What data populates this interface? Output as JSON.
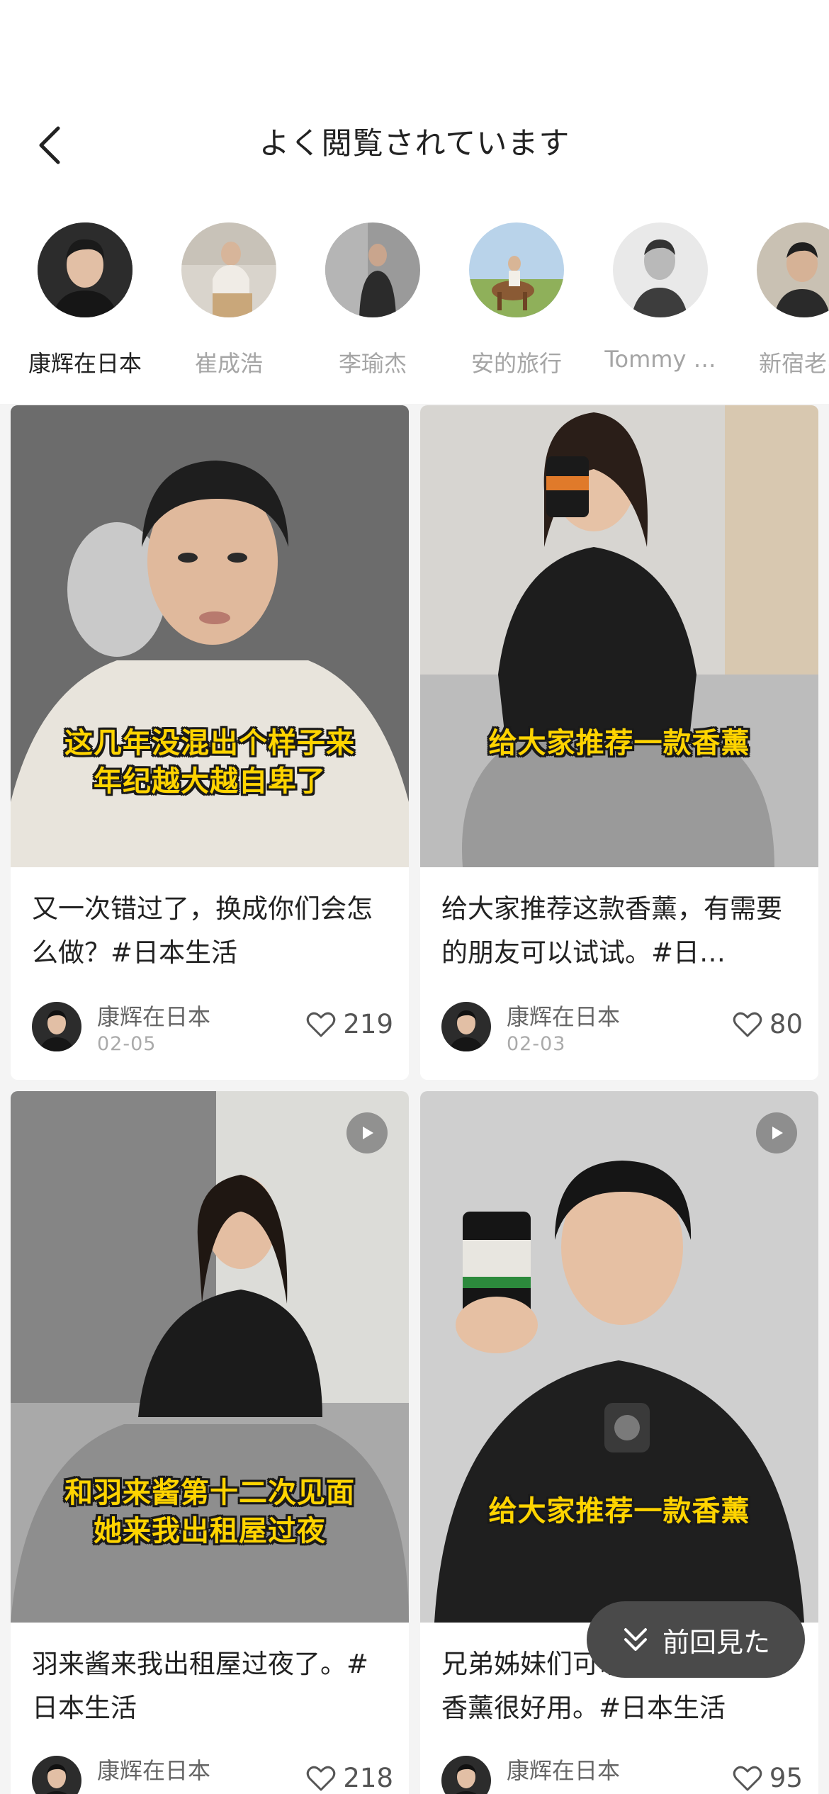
{
  "header": {
    "title": "よく閲覧されています",
    "back_icon": "chevron-left-icon"
  },
  "avatars": [
    {
      "name": "康辉在日本",
      "active": true
    },
    {
      "name": "崔成浩",
      "active": false
    },
    {
      "name": "李瑜杰",
      "active": false
    },
    {
      "name": "安的旅行",
      "active": false
    },
    {
      "name": "Tommy …",
      "active": false
    },
    {
      "name": "新宿老张",
      "active": false
    }
  ],
  "cards": [
    {
      "overlay_lines": [
        "这几年没混出个样子来",
        "年纪越大越自卑了"
      ],
      "text": "又一次错过了，换成你们会怎么做？#日本生活",
      "author": "康辉在日本",
      "date": "02-05",
      "likes": "219",
      "is_video": false
    },
    {
      "overlay_lines": [
        "给大家推荐一款香薰"
      ],
      "text": "给大家推荐这款香薰，有需要的朋友可以试试。#日…",
      "author": "康辉在日本",
      "date": "02-03",
      "likes": "80",
      "is_video": false
    },
    {
      "overlay_lines": [
        "和羽来酱第十二次见面",
        "她来我出租屋过夜"
      ],
      "text": "羽来酱来我出租屋过夜了。#日本生活",
      "author": "康辉在日本",
      "date": "",
      "likes": "218",
      "is_video": true
    },
    {
      "overlay_lines": [
        "给大家推荐一款香薰"
      ],
      "text": "兄弟姊妹们可以试一试，这款香薰很好用。#日本生活",
      "author": "康辉在日本",
      "date": "",
      "likes": "95",
      "is_video": true
    }
  ],
  "floating_button": {
    "label": "前回見た",
    "icon": "double-chevron-down-icon"
  },
  "colors": {
    "overlay_text": "#ffd400",
    "floating_bg": "#4a4a4a",
    "page_bg": "#f4f4f4"
  }
}
